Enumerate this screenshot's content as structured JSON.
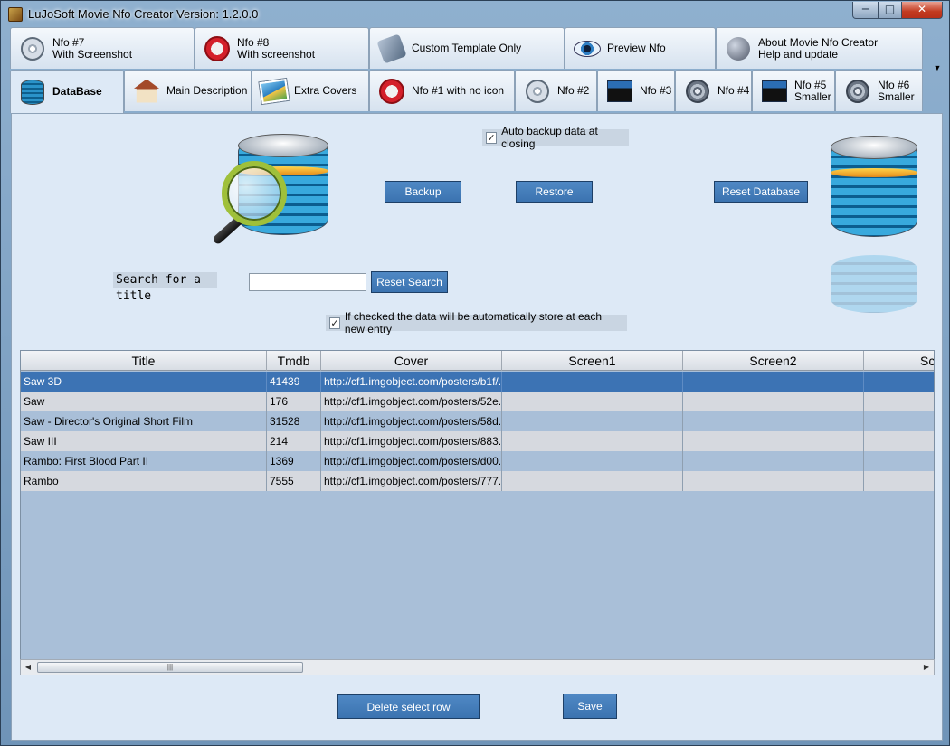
{
  "window": {
    "title": "LuJoSoft Movie Nfo Creator Version: 1.2.0.0"
  },
  "tabs_row1": [
    {
      "label": "Nfo #7\nWith Screenshot",
      "icon": "film-reel-icon"
    },
    {
      "label": "Nfo #8\nWith screenshot",
      "icon": "no-entry-icon"
    },
    {
      "label": "Custom Template Only",
      "icon": "tools-icon"
    },
    {
      "label": "Preview Nfo",
      "icon": "eye-icon"
    },
    {
      "label": "About Movie Nfo Creator\nHelp and update",
      "icon": "pen-icon"
    }
  ],
  "tabs_row2": [
    {
      "label": "DataBase",
      "icon": "database-icon",
      "active": true
    },
    {
      "label": "Main Description",
      "icon": "house-icon"
    },
    {
      "label": "Extra Covers",
      "icon": "photo-icon"
    },
    {
      "label": "Nfo #1 with no icon",
      "icon": "no-entry-icon"
    },
    {
      "label": "Nfo #2",
      "icon": "film-reel-icon"
    },
    {
      "label": "Nfo #3",
      "icon": "clapper-icon"
    },
    {
      "label": "Nfo #4",
      "icon": "reel-icon"
    },
    {
      "label": "Nfo #5\nSmaller",
      "icon": "clapper-icon"
    },
    {
      "label": "Nfo #6\nSmaller",
      "icon": "reel-icon"
    }
  ],
  "database": {
    "auto_backup_label": "Auto backup data at closing",
    "auto_backup_checked": true,
    "backup_label": "Backup",
    "restore_label": "Restore",
    "reset_db_label": "Reset Database",
    "search_label": "Search for a title",
    "search_value": "",
    "reset_search_label": "Reset Search",
    "auto_store_label": "If checked the data will be automatically store at each new entry",
    "auto_store_checked": true,
    "check_mark": "✓",
    "delete_label": "Delete select row",
    "save_label": "Save"
  },
  "grid": {
    "columns": [
      "Title",
      "Tmdb",
      "Cover",
      "Screen1",
      "Screen2",
      "Sc"
    ],
    "rows": [
      [
        "Saw 3D",
        "41439",
        "http://cf1.imgobject.com/posters/b1f/...",
        "",
        "",
        ""
      ],
      [
        "Saw",
        "176",
        "http://cf1.imgobject.com/posters/52e...",
        "",
        "",
        ""
      ],
      [
        "Saw - Director's Original Short Film",
        "31528",
        "http://cf1.imgobject.com/posters/58d...",
        "",
        "",
        ""
      ],
      [
        "Saw III",
        "214",
        "http://cf1.imgobject.com/posters/883...",
        "",
        "",
        ""
      ],
      [
        "Rambo: First Blood Part II",
        "1369",
        "http://cf1.imgobject.com/posters/d00...",
        "",
        "",
        ""
      ],
      [
        "Rambo",
        "7555",
        "http://cf1.imgobject.com/posters/777...",
        "",
        "",
        ""
      ]
    ],
    "selected_row": 0
  },
  "colors": {
    "accent": "#3c73b4",
    "panel": "#dde9f6"
  }
}
